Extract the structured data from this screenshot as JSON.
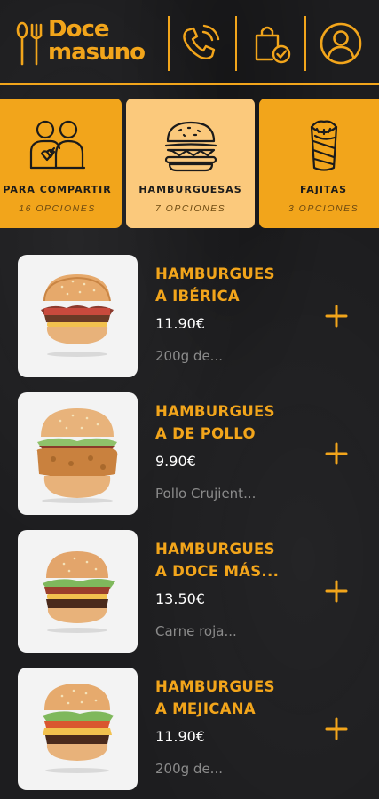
{
  "header": {
    "logo_line1": "Doce",
    "logo_line2": "masuno",
    "icons": [
      "phone-icon",
      "shopping-bag-check-icon",
      "user-icon"
    ]
  },
  "categories": [
    {
      "label": "PARA COMPARTIR",
      "count": "16 OPCIONES",
      "icon": "sharing-people-icon",
      "active": false
    },
    {
      "label": "HAMBURGUESAS",
      "count": "7 OPCIONES",
      "icon": "burger-icon",
      "active": true
    },
    {
      "label": "FAJITAS",
      "count": "3 OPCIONES",
      "icon": "fajita-wrap-icon",
      "active": false
    }
  ],
  "items": [
    {
      "name_line1": "HAMBURGUES",
      "name_line2": "A IBÉRICA",
      "price": "11.90€",
      "desc": "200g de..."
    },
    {
      "name_line1": "HAMBURGUES",
      "name_line2": "A DE POLLO",
      "price": "9.90€",
      "desc": "Pollo Crujient..."
    },
    {
      "name_line1": "HAMBURGUES",
      "name_line2": "A DOCE MÁS...",
      "price": "13.50€",
      "desc": "Carne roja..."
    },
    {
      "name_line1": "HAMBURGUES",
      "name_line2": "A MEJICANA",
      "price": "11.90€",
      "desc": "200g de..."
    }
  ],
  "colors": {
    "accent": "#f2a51b",
    "active_category": "#fbc97c",
    "background": "#1d1d1f"
  }
}
